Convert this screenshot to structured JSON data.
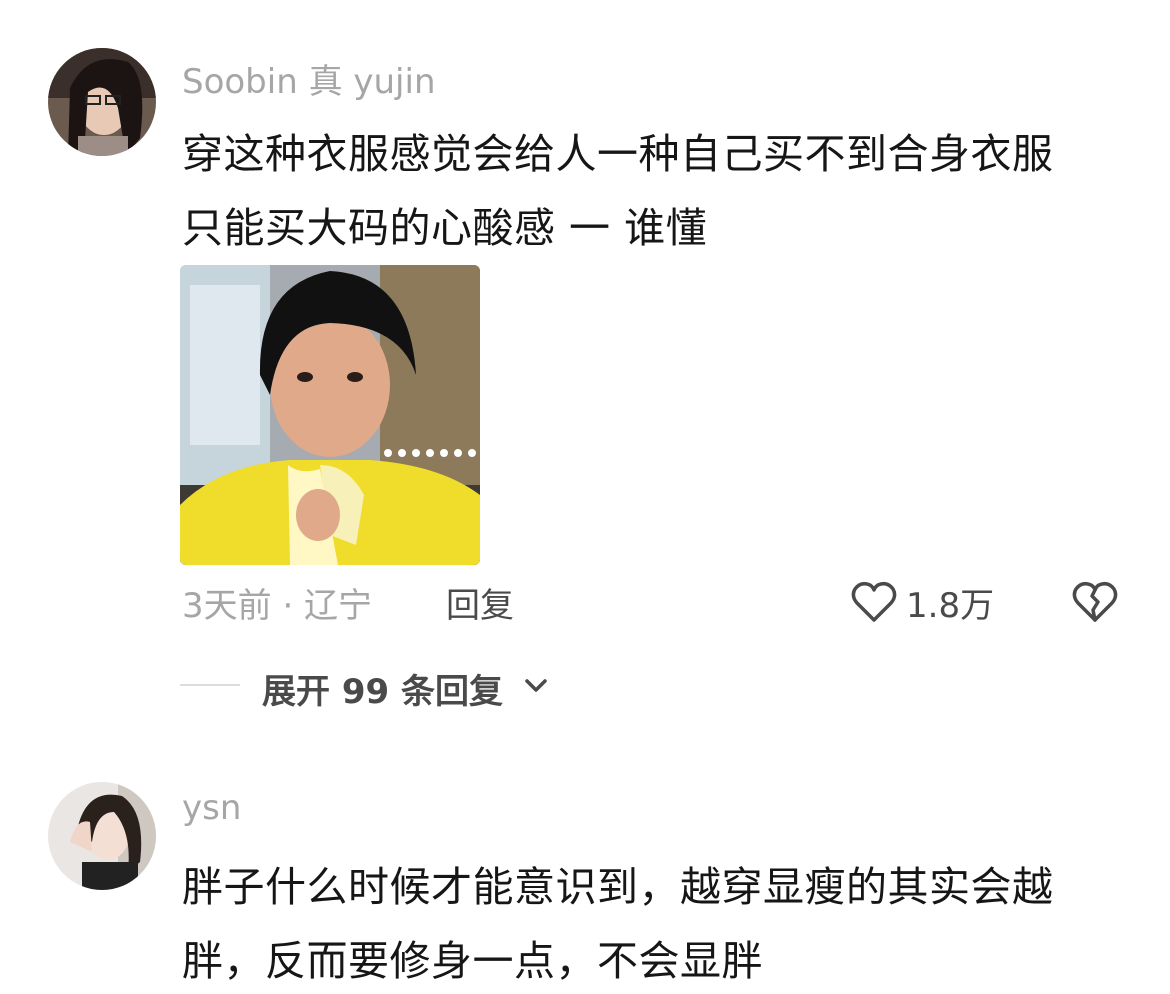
{
  "comments": [
    {
      "username": "Soobin 真 yujin",
      "lines": [
        "穿这种衣服感觉会给人一种自己买不到合身衣服",
        "只能买大码的心酸感 一 谁懂"
      ],
      "time_location": "3天前 · 辽宁",
      "reply_label": "回复",
      "like_count": "1.8万",
      "expand_label": "展开 99 条回复"
    },
    {
      "username": "ysn",
      "lines": [
        "胖子什么时候才能意识到，越穿显瘦的其实会越",
        "胖，反而要修身一点，不会显胖"
      ]
    }
  ],
  "icons": {
    "like": "heart-outline-icon",
    "dislike": "broken-heart-icon",
    "expand": "chevron-down-icon"
  },
  "colors": {
    "username": "#a6a6a6",
    "text": "#161616",
    "meta": "#4a4a4a"
  }
}
